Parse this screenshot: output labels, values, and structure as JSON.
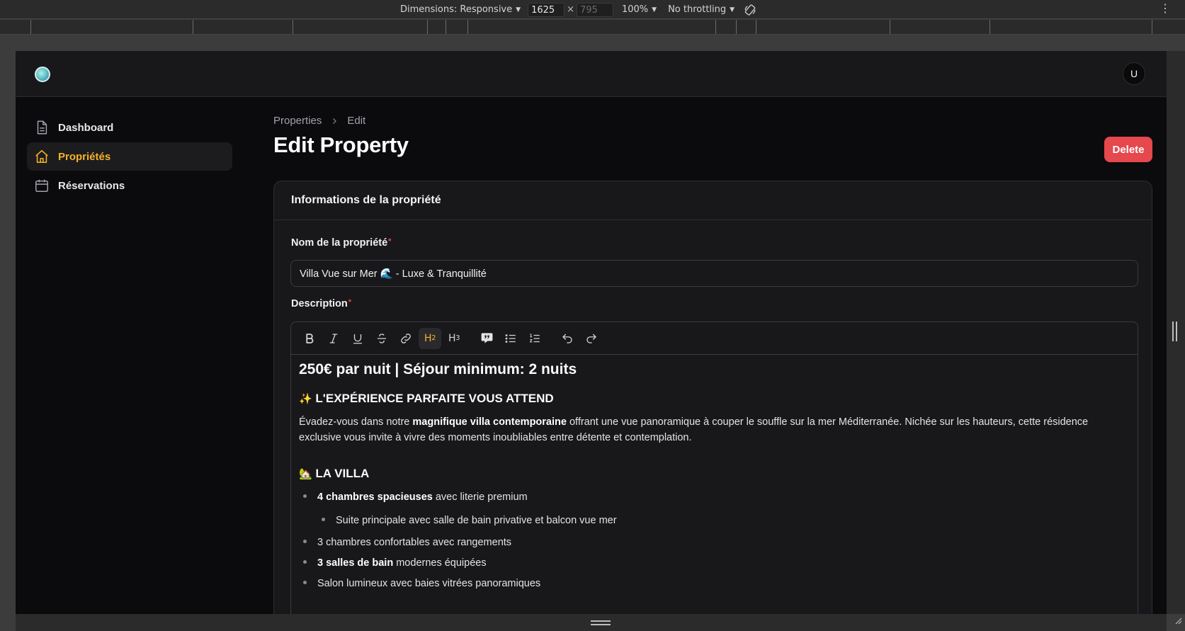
{
  "devtools": {
    "dimensions_label": "Dimensions: Responsive",
    "width": "1625",
    "height": "795",
    "zoom": "100%",
    "throttling": "No throttling",
    "more_icon": "⋮"
  },
  "app": {
    "avatar_initial": "U"
  },
  "sidebar": {
    "items": [
      {
        "label": "Dashboard",
        "icon": "document-icon",
        "active": false
      },
      {
        "label": "Propriétés",
        "icon": "home-icon",
        "active": true
      },
      {
        "label": "Réservations",
        "icon": "calendar-icon",
        "active": false
      }
    ]
  },
  "breadcrumb": {
    "items": [
      "Properties",
      "Edit"
    ]
  },
  "page": {
    "title": "Edit Property",
    "delete_label": "Delete"
  },
  "form": {
    "section_title": "Informations de la propriété",
    "name_label": "Nom de la propriété",
    "name_value": "Villa Vue sur Mer 🌊 - Luxe & Tranquillité",
    "description_label": "Description",
    "required_mark": "*"
  },
  "editor": {
    "toolbar": [
      "bold",
      "italic",
      "underline",
      "strikethrough",
      "link",
      "h2",
      "h3",
      "blockquote",
      "bullet-list",
      "ordered-list",
      "undo",
      "redo"
    ],
    "active_tool": "h2",
    "h2_label": "H",
    "h2_sub": "2",
    "h3_label": "H",
    "h3_sub": "3",
    "content": {
      "heading_price": "250€ par nuit | Séjour minimum: 2 nuits",
      "heading_experience_emoji": "✨",
      "heading_experience": "L'EXPÉRIENCE PARFAITE VOUS ATTEND",
      "intro_before": "Évadez-vous dans notre ",
      "intro_bold": "magnifique villa contemporaine",
      "intro_after": " offrant une vue panoramique à couper le souffle sur la mer Méditerranée. Nichée sur les hauteurs, cette résidence exclusive vous invite à vivre des moments inoubliables entre détente et contemplation.",
      "heading_villa_emoji": "🏡",
      "heading_villa": "LA VILLA",
      "list": [
        {
          "bold": "4 chambres spacieuses",
          "text": " avec literie premium",
          "level": 1
        },
        {
          "bold": "",
          "text": "Suite principale avec salle de bain privative et balcon vue mer",
          "level": 2
        },
        {
          "bold": "",
          "text": "3 chambres confortables avec rangements",
          "level": 1
        },
        {
          "bold": "3 salles de bain",
          "text": " modernes équipées",
          "level": 1
        },
        {
          "bold": "",
          "text": "Salon lumineux avec baies vitrées panoramiques",
          "level": 1
        }
      ]
    }
  },
  "colors": {
    "accent": "#f5b325",
    "danger": "#e5484d",
    "background": "#0b0b0d",
    "surface": "#18181b"
  }
}
